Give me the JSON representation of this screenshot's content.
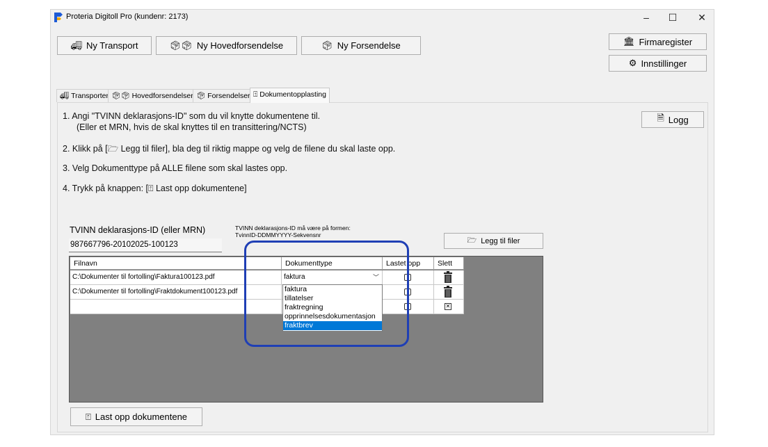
{
  "window": {
    "title": "Proteria Digitoll Pro (kundenr: 2173)",
    "minimize": "–",
    "maximize": "☐",
    "close": "✕"
  },
  "toolbar": {
    "ny_transport": "Ny Transport",
    "ny_hovedforsendelse": "Ny Hovedforsendelse",
    "ny_forsendelse": "Ny Forsendelse",
    "firmaregister": "Firmaregister",
    "innstillinger": "Innstillinger"
  },
  "tabs": [
    {
      "label": "Transporter",
      "icon": "truck-icon"
    },
    {
      "label": "Hovedforsendelser",
      "icon": "boxes-icon"
    },
    {
      "label": "Forsendelser",
      "icon": "box-icon"
    },
    {
      "label": "Dokumentopplasting",
      "icon": "upload-icon",
      "active": true
    }
  ],
  "logg_button": "Logg",
  "instructions": {
    "step1_line1": "1. Angi \"TVINN deklarasjons-ID\" som du vil knytte dokumentene til.",
    "step1_line2": "(Eller et MRN, hvis de skal knyttes til en transittering/NCTS)",
    "step2": "2. Klikk på [🗁 Legg til filer], bla deg til riktig mappe og velg de filene du skal laste opp.",
    "step3": "3. Velg Dokumenttype på ALLE filene som skal lastes opp.",
    "step4": "4. Trykk på knappen: [⍐ Last opp dokumentene]"
  },
  "form": {
    "tvinn_label": "TVINN deklarasjons-ID (eller MRN)",
    "tvinn_value": "987667796-20102025-100123",
    "format_note_line1": "TVINN deklarasjons-ID må være på formen:",
    "format_note_line2": "TvinnID-DDMMYYYY-Sekvensnr",
    "add_files_button": "Legg til filer"
  },
  "grid": {
    "columns": [
      "Filnavn",
      "Dokumenttype",
      "Lastet opp",
      "Slett"
    ],
    "rows": [
      {
        "filnavn": "C:\\Dokumenter til fortolling\\Faktura100123.pdf",
        "dokumenttype": "faktura"
      },
      {
        "filnavn": "C:\\Dokumenter til fortolling\\Fraktdokument100123.pdf",
        "dokumenttype": ""
      },
      {
        "filnavn": "",
        "dokumenttype": ""
      }
    ]
  },
  "dropdown": {
    "options": [
      "faktura",
      "tillatelser",
      "fraktregning",
      "opprinnelsesdokumentasjon",
      "fraktbrev"
    ],
    "highlighted": "fraktbrev"
  },
  "upload_button": "Last opp dokumentene",
  "colors": {
    "selection": "#0078d7",
    "highlight_ring": "#1f3fb5",
    "grid_background": "#808080"
  }
}
